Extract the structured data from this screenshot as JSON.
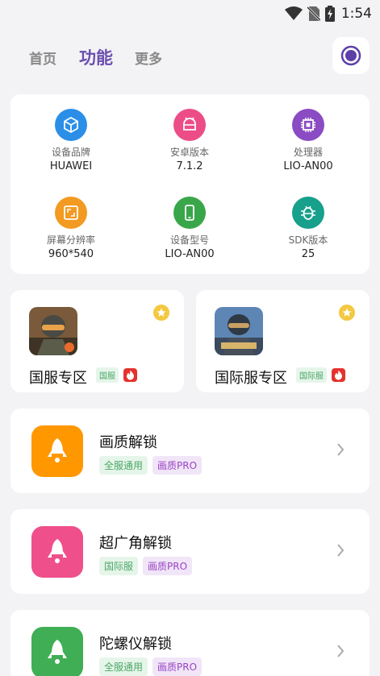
{
  "status_bar": {
    "time": "1:54",
    "icons": [
      "wifi-icon",
      "no-sim-icon",
      "battery-charging-icon"
    ]
  },
  "nav": {
    "tabs": [
      "首页",
      "功能",
      "更多"
    ],
    "active_tab": "功能",
    "record_icon": "record-icon"
  },
  "device_info": [
    {
      "label": "设备品牌",
      "value": "HUAWEI",
      "icon": "cube-icon",
      "color": "#2b8fe8"
    },
    {
      "label": "安卓版本",
      "value": "7.1.2",
      "icon": "android-icon",
      "color": "#ec4d87"
    },
    {
      "label": "处理器",
      "value": "LIO-AN00",
      "icon": "chip-icon",
      "color": "#8a4bc3"
    },
    {
      "label": "屏幕分辨率",
      "value": "960*540",
      "icon": "screen-icon",
      "color": "#f39a22"
    },
    {
      "label": "设备型号",
      "value": "LIO-AN00",
      "icon": "phone-icon",
      "color": "#39a64a"
    },
    {
      "label": "SDK版本",
      "value": "25",
      "icon": "bug-icon",
      "color": "#17a08c"
    }
  ],
  "servers": [
    {
      "title": "国服专区",
      "tag": "国服",
      "thumb_icon": "game-thumbnail-cn"
    },
    {
      "title": "国际服专区",
      "tag": "国际服",
      "thumb_icon": "game-thumbnail-global"
    }
  ],
  "unlocks": [
    {
      "title": "画质解锁",
      "tags": [
        "全服通用",
        "画质PRO"
      ],
      "color": "#ff9800",
      "icon": "rocket-icon"
    },
    {
      "title": "超广角解锁",
      "tags": [
        "国际服",
        "画质PRO"
      ],
      "color": "#ef4f8a",
      "icon": "rocket-icon"
    },
    {
      "title": "陀螺仪解锁",
      "tags": [
        "全服通用",
        "画质PRO"
      ],
      "color": "#3fae55",
      "icon": "rocket-icon"
    }
  ]
}
